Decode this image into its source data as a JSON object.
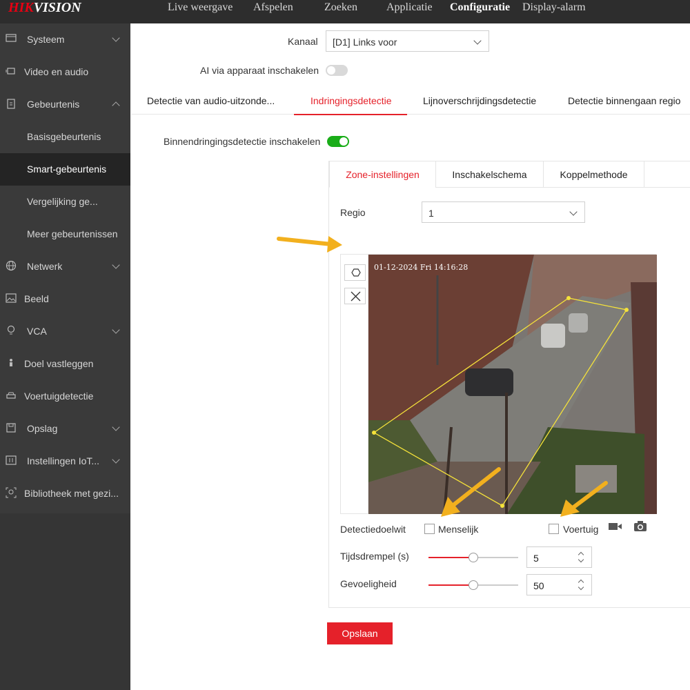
{
  "brand": {
    "logo_red": "HIK",
    "logo_white": "VISION",
    "accent": "#e5212a"
  },
  "topnav": [
    {
      "label": "Live weergave"
    },
    {
      "label": "Afspelen"
    },
    {
      "label": "Zoeken"
    },
    {
      "label": "Applicatie"
    },
    {
      "label": "Configuratie",
      "active": true
    },
    {
      "label": "Display-alarm"
    }
  ],
  "sidebar": {
    "items": [
      {
        "label": "Systeem",
        "icon": "monitor-icon",
        "expand": "chevron-down-icon"
      },
      {
        "label": "Video en audio",
        "icon": "video-icon"
      },
      {
        "label": "Gebeurtenis",
        "icon": "clipboard-icon",
        "expand": "chevron-up-icon"
      },
      {
        "label": "Basisgebeurtenis"
      },
      {
        "label": "Smart-gebeurtenis",
        "selected": true
      },
      {
        "label": "Vergelijking ge..."
      },
      {
        "label": "Meer gebeurtenissen"
      },
      {
        "label": "Netwerk",
        "icon": "globe-icon",
        "expand": "chevron-down-icon"
      },
      {
        "label": "Beeld",
        "icon": "image-icon"
      },
      {
        "label": "VCA",
        "icon": "bulb-icon",
        "expand": "chevron-down-icon"
      },
      {
        "label": "Doel vastleggen",
        "icon": "person-target-icon"
      },
      {
        "label": "Voertuigdetectie",
        "icon": "car-icon"
      },
      {
        "label": "Opslag",
        "icon": "save-icon",
        "expand": "chevron-down-icon"
      },
      {
        "label": "Instellingen IoT...",
        "icon": "iot-icon",
        "expand": "chevron-down-icon"
      },
      {
        "label": "Bibliotheek met gezi...",
        "icon": "face-icon"
      }
    ]
  },
  "main": {
    "channel_label": "Kanaal",
    "channel_value": "[D1] Links voor",
    "ai_label": "AI via apparaat inschakelen",
    "ai_enabled": false,
    "tabs": [
      {
        "label": "Detectie van audio-uitzonde..."
      },
      {
        "label": "Indringingsdetectie",
        "active": true
      },
      {
        "label": "Lijnoverschrijdingsdetectie"
      },
      {
        "label": "Detectie binnengaan regio"
      }
    ],
    "intrusion_label": "Binnendringingsdetectie inschakelen",
    "intrusion_enabled": true,
    "subtabs": [
      {
        "label": "Zone-instellingen",
        "active": true
      },
      {
        "label": "Inschakelschema"
      },
      {
        "label": "Koppelmethode"
      }
    ],
    "region_label": "Regio",
    "region_value": "1",
    "osd_timestamp": "01-12-2024 Fri 14:16:28",
    "target_label": "Detectiedoelwit",
    "target_options": [
      {
        "label": "Menselijk",
        "checked": false
      },
      {
        "label": "Voertuig",
        "checked": false
      }
    ],
    "threshold_label": "Tijdsdrempel (s)",
    "threshold_value": "5",
    "threshold_level": 0.5,
    "sensitivity_label": "Gevoeligheid",
    "sensitivity_value": "50",
    "sensitivity_level": 0.5,
    "save_label": "Opslaan"
  },
  "colors": {
    "toggle_on": "#1aad19",
    "toggle_off": "#d9d9d9",
    "zone_line": "#f5e23a",
    "annotation_arrow": "#f2b01e"
  }
}
